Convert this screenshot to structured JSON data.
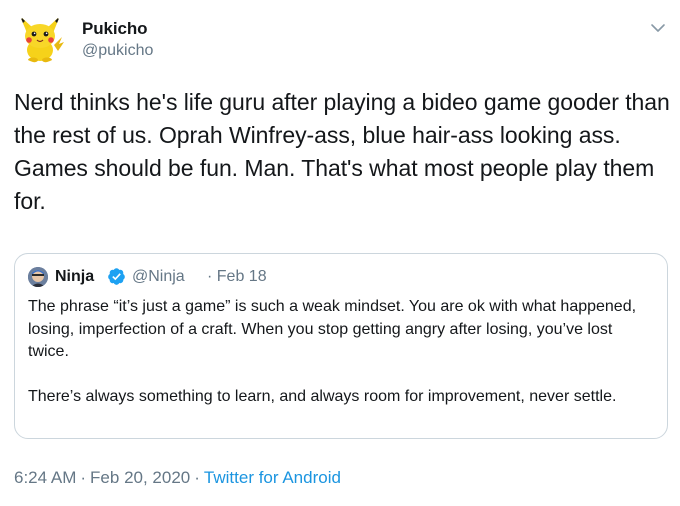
{
  "author": {
    "display_name": "Pukicho",
    "handle": "@pukicho",
    "avatar_icon": "pikachu-plush-avatar"
  },
  "tweet": {
    "text": "Nerd thinks he's life guru after playing a bideo game gooder than the rest of us. Oprah Winfrey-ass, blue hair-ass looking ass. Games should be fun. Man. That's what most people play them for.",
    "menu_icon": "chevron-down-icon"
  },
  "quoted_tweet": {
    "display_name": "Ninja",
    "verified_icon": "verified-badge-icon",
    "handle": "@Ninja",
    "date": "· Feb 18",
    "paragraph_1": "The phrase “it’s just a game” is such a weak mindset. You are ok with what happened, losing, imperfection of a craft. When you stop getting angry after losing, you’ve lost twice.",
    "paragraph_2": "There’s always something to learn, and always room for improvement, never settle."
  },
  "meta": {
    "time": "6:24 AM",
    "separator": "·",
    "date": "Feb 20, 2020",
    "source": "Twitter for Android"
  },
  "colors": {
    "text": "#14171a",
    "secondary": "#657786",
    "link": "#1b95e0",
    "border": "#ccd6dd",
    "verified": "#1da1f2"
  }
}
